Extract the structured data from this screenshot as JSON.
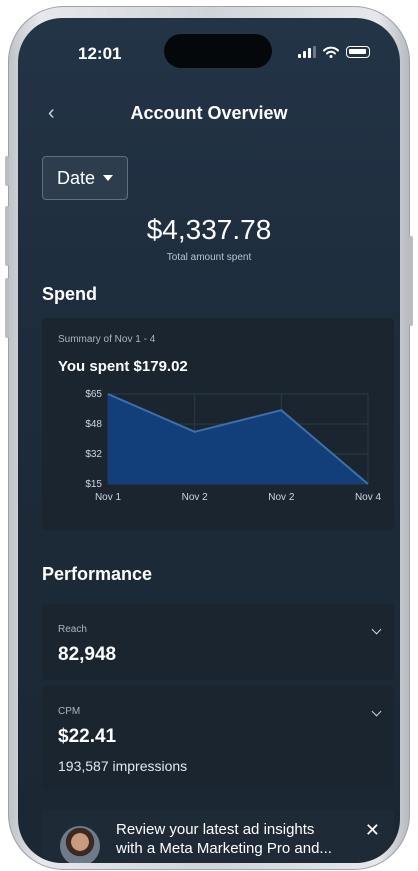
{
  "status_bar": {
    "time": "12:01"
  },
  "header": {
    "back": "‹",
    "title": "Account Overview"
  },
  "date_filter": {
    "label": "Date"
  },
  "total": {
    "amount": "$4,337.78",
    "label": "Total amount spent"
  },
  "spend": {
    "heading": "Spend",
    "summary": "Summary of Nov 1 - 4",
    "spent_text": "You spent $179.02"
  },
  "chart_data": {
    "type": "area",
    "x": [
      "Nov 1",
      "Nov 2",
      "Nov 2",
      "Nov 4"
    ],
    "values": [
      65,
      44,
      56,
      15
    ],
    "y_ticks": [
      "$65",
      "$48",
      "$32",
      "$15"
    ],
    "ylim": [
      15,
      65
    ],
    "fill_color": "#123e7a",
    "line_color": "#3f6fa8"
  },
  "performance": {
    "heading": "Performance",
    "reach": {
      "label": "Reach",
      "value": "82,948"
    },
    "cpm": {
      "label": "CPM",
      "value": "$22.41",
      "extra": "193,587 impressions"
    }
  },
  "banner": {
    "text": "Review your latest ad insights\nwith a Meta Marketing Pro and...",
    "close": "✕"
  },
  "icons": [
    "back-icon",
    "caret-down-icon",
    "chevron-down-icon",
    "close-icon",
    "signal-icon",
    "wifi-icon",
    "battery-icon",
    "avatar"
  ]
}
